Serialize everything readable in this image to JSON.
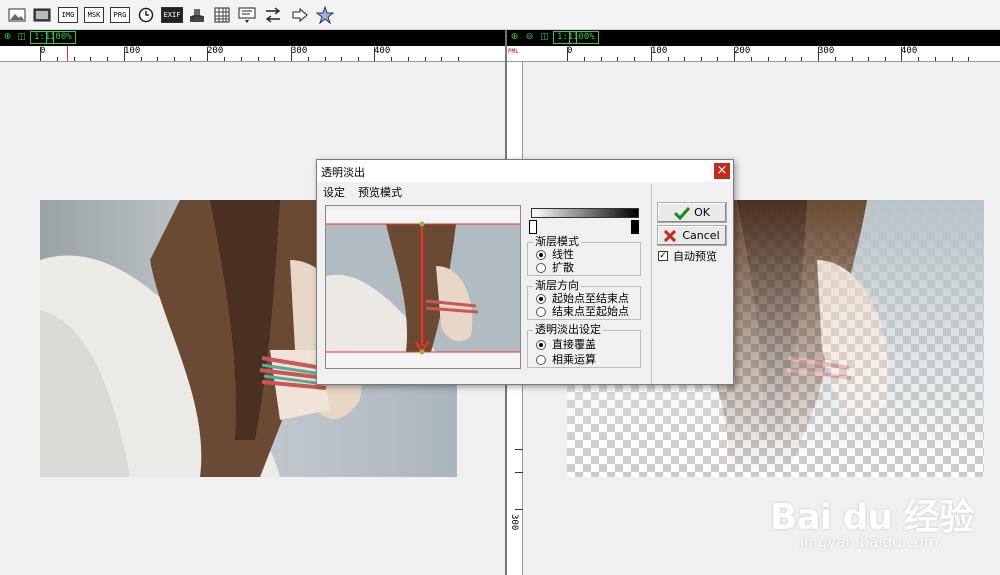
{
  "toolbar": {
    "labels": {
      "img": "IMG",
      "msk": "MSK",
      "prg": "PRG",
      "exif": "EXIF"
    },
    "icons": [
      "image-icon",
      "frame-icon",
      "img-icon",
      "msk-icon",
      "prg-icon",
      "clock-icon",
      "exif-icon",
      "stamp-icon",
      "grid-icon",
      "comment-icon",
      "swap-icon",
      "arrow-right-icon",
      "star-icon"
    ]
  },
  "left_panel": {
    "zoom": "100%",
    "fit_label": "1:1"
  },
  "right_panel": {
    "zoom": "100%",
    "fit_label": "1:1",
    "badge": "PML"
  },
  "ruler": {
    "labels": [
      "0",
      "100",
      "200",
      "300",
      "400"
    ],
    "vlabel": "300"
  },
  "dialog": {
    "title": "透明淡出",
    "menu": [
      "设定",
      "预览模式"
    ],
    "gradient_mode": {
      "legend": "渐层模式",
      "options": [
        "线性",
        "扩散"
      ],
      "selected": 0
    },
    "gradient_direction": {
      "legend": "渐层方向",
      "options": [
        "起始点至结束点",
        "结束点至起始点"
      ],
      "selected": 0
    },
    "fade_setting": {
      "legend": "透明淡出设定",
      "options": [
        "直接覆盖",
        "相乘运算"
      ],
      "selected": 0
    },
    "ok_label": "OK",
    "cancel_label": "Cancel",
    "auto_preview_label": "自动预览",
    "auto_preview_checked": true,
    "close_glyph": "×"
  },
  "watermark": {
    "logo": "Bai du 经验",
    "url": "jingyan.baidu.com"
  },
  "colors": {
    "accent_green": "#2ecc40",
    "close_red": "#c42b1c",
    "guide_red": "#ff2a2a"
  }
}
